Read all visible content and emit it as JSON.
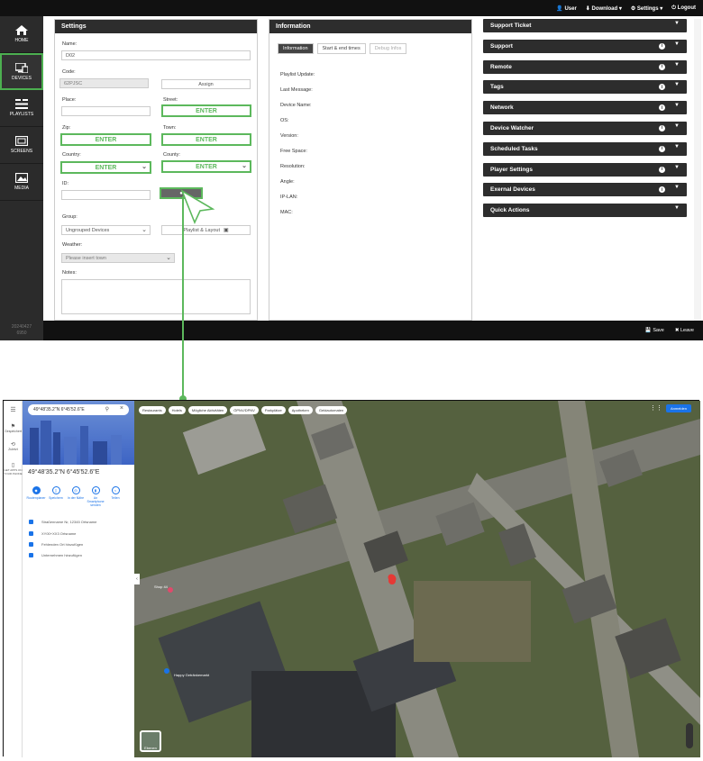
{
  "topbar": {
    "user": "User",
    "download": "Download",
    "settings": "Settings",
    "logout": "Logout"
  },
  "sidebar": {
    "items": [
      {
        "label": "HOME",
        "icon": "home-icon"
      },
      {
        "label": "DEVICES",
        "icon": "devices-icon",
        "active": true
      },
      {
        "label": "PLAYLISTS",
        "icon": "playlists-icon"
      },
      {
        "label": "SCREENS",
        "icon": "screens-icon"
      },
      {
        "label": "MEDIA",
        "icon": "media-icon"
      }
    ],
    "version_line1": "20240427",
    "version_line2": "6950"
  },
  "settings": {
    "title": "Settings",
    "name_label": "Name:",
    "name_value": "D02",
    "code_label": "Code:",
    "code_value": "62PJSC",
    "assign_label": "Assign",
    "place_label": "Place:",
    "street_label": "Street:",
    "street_value": "ENTER",
    "zip_label": "Zip:",
    "zip_value": "ENTER",
    "town_label": "Town:",
    "town_value": "ENTER",
    "country_label": "Country:",
    "country_value": "ENTER",
    "county_label": "County:",
    "county_value": "ENTER",
    "id_label": "ID:",
    "group_label": "Group:",
    "group_value": "Ungrouped Devices",
    "playlist_layout_label": "Playlist & Layout",
    "weather_label": "Weather:",
    "weather_value": "Please insert town",
    "notes_label": "Notes:"
  },
  "information": {
    "title": "Information",
    "tabs": [
      "Information",
      "Start & end times",
      "Debug Infos"
    ],
    "rows": [
      "Playlist Update:",
      "Last Message:",
      "Device Name:",
      "OS:",
      "Version:",
      "Free Space:",
      "Resolution:",
      "Angle:",
      "IP-LAN:",
      "MAC:"
    ]
  },
  "right_panels": [
    {
      "label": "Support Ticket",
      "info": false
    },
    {
      "label": "Support",
      "info": true
    },
    {
      "label": "Remote",
      "info": true
    },
    {
      "label": "Tags",
      "info": true
    },
    {
      "label": "Network",
      "info": true
    },
    {
      "label": "Device Watcher",
      "info": true
    },
    {
      "label": "Scheduled Tasks",
      "info": true
    },
    {
      "label": "Player Settings",
      "info": true
    },
    {
      "label": "Exernal Devices",
      "info": true
    },
    {
      "label": "Quick Actions",
      "info": false
    }
  ],
  "bottombar": {
    "save": "Save",
    "leave": "Leave"
  },
  "map": {
    "search_value": "49°48'35.2\"N 6°45'52.6\"E",
    "coord_title": "49°48'35.2\"N 6°45'52.6\"E",
    "left_items": [
      "Gespeichert",
      "Zuletzt",
      "GET APPS ON YOUR PHONE"
    ],
    "actions": [
      "Routenplaner",
      "Speichern",
      "In der Nähe",
      "An Smartphone senden",
      "Teilen"
    ],
    "rows": [
      "Straßenname Nr, 12345 Ortsname",
      "XY00+XX3 Ortsname",
      "Fehlenden Ort hinzufügen",
      "Unternehmen hinzufügen"
    ],
    "chips": [
      "Restaurants",
      "Hotels",
      "Mögliche Aktivitäten",
      "ÖPNV/DPNV",
      "Parkplätze",
      "Apotheken",
      "Geldautomaten"
    ],
    "login": "Anmelden",
    "layers": "Ebenen",
    "place_label": "Happy Getränkemarkt",
    "poi_label": "Shop 44"
  },
  "colors": {
    "accent": "#5cb85c",
    "dark": "#2d2d2d",
    "map_blue": "#1a73e8"
  }
}
